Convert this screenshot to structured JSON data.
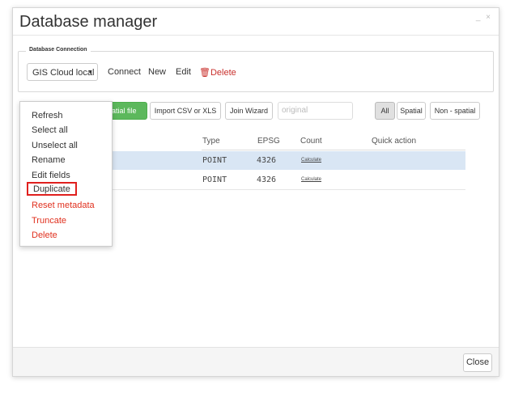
{
  "window": {
    "title": "Database manager",
    "minimize": "_",
    "close": "×"
  },
  "connection": {
    "legend": "Database Connection",
    "selected": "GIS Cloud local",
    "actions": {
      "connect": "Connect",
      "new": "New",
      "edit": "Edit",
      "delete": "Delete"
    }
  },
  "toolbar": {
    "upload_label": "spatial file",
    "import_label": "Import CSV or XLS",
    "join_label": "Join Wizard",
    "search_value": "original",
    "filters": [
      "All",
      "Spatial",
      "Non - spatial"
    ],
    "active_filter": "All"
  },
  "table": {
    "headers": [
      "Type",
      "EPSG",
      "Count",
      "Quick action"
    ],
    "rows": [
      {
        "type": "POINT",
        "epsg": "4326",
        "count": "Calculate",
        "selected": true
      },
      {
        "type": "POINT",
        "epsg": "4326",
        "count": "Calculate",
        "selected": false
      }
    ]
  },
  "context_menu": {
    "items": [
      "Refresh",
      "Select all",
      "Unselect all",
      "Rename",
      "Edit fields",
      "Duplicate",
      "Reset metadata",
      "Truncate",
      "Delete"
    ],
    "highlighted": "Duplicate",
    "danger_items": [
      "Reset metadata",
      "Truncate",
      "Delete"
    ]
  },
  "footer": {
    "close_label": "Close"
  },
  "colors": {
    "accent_green": "#5cb85c",
    "danger": "#e0301e",
    "highlight_box": "#e0201e",
    "selected_row": "#d9e6f4"
  }
}
